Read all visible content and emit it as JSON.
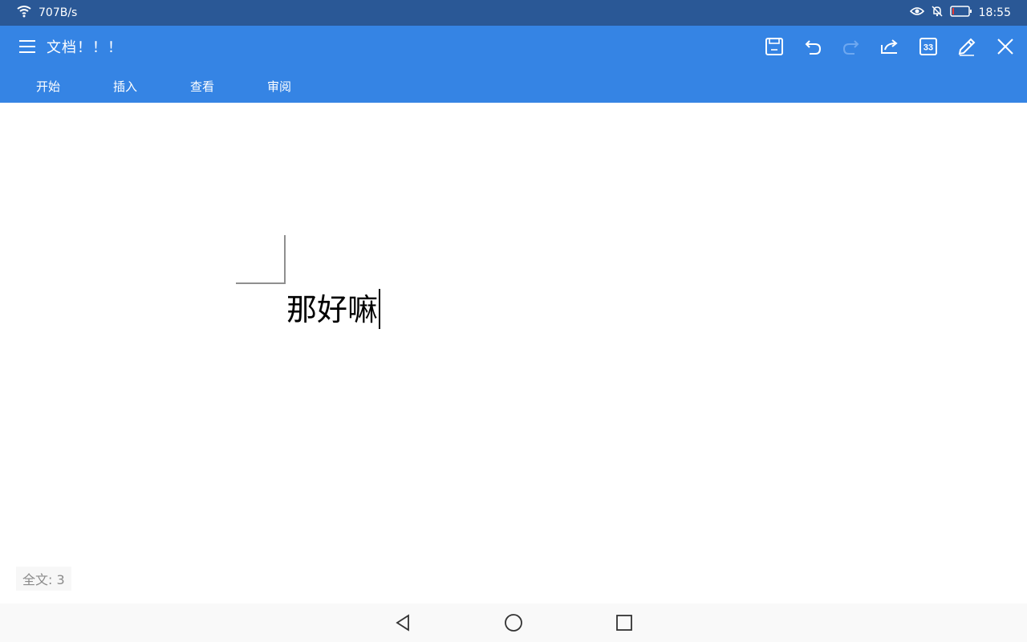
{
  "status_bar": {
    "net_speed": "707B/s",
    "time": "18:55",
    "icons": [
      "wifi-icon",
      "eye-icon",
      "mute-bell-icon",
      "battery-icon"
    ]
  },
  "app_bar": {
    "title": "文档！！！",
    "action_icons": [
      "save-icon",
      "undo-icon",
      "redo-icon",
      "share-icon",
      "page-count-icon",
      "edit-icon",
      "close-icon"
    ],
    "page_count": "33",
    "tabs": [
      "开始",
      "插入",
      "查看",
      "审阅"
    ]
  },
  "document": {
    "text": "那好嘛",
    "word_count_label": "全文: 3"
  },
  "nav_bar": {
    "icons": [
      "back-icon",
      "home-icon",
      "recents-icon"
    ]
  },
  "colors": {
    "status_bar": "#2a5896",
    "app_bar": "#3584e4",
    "disabled_icon": "#6ea8f0"
  }
}
